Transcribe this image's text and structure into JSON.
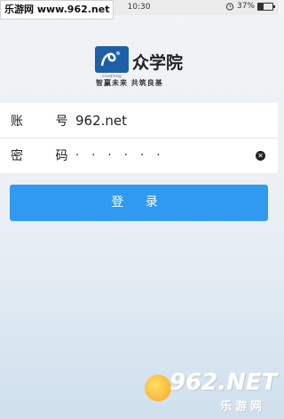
{
  "status_bar": {
    "time": "10:30",
    "battery_text": "37%",
    "battery_level": 0.37
  },
  "watermark_top": "乐游网 www.962.net",
  "logo": {
    "name": "众学院",
    "slogan": "智赢未来  共筑良基",
    "mark_caption": "e-Learning"
  },
  "form": {
    "account_label": "账 号",
    "account_value": "962.net",
    "password_label": "密 码",
    "password_value": "· · · · · ·"
  },
  "login_button": "登 录",
  "watermark_bottom": {
    "big": "962.NET",
    "small": "乐游网"
  },
  "colors": {
    "accent": "#2f9af0",
    "logo_blue": "#1f5fa8"
  }
}
